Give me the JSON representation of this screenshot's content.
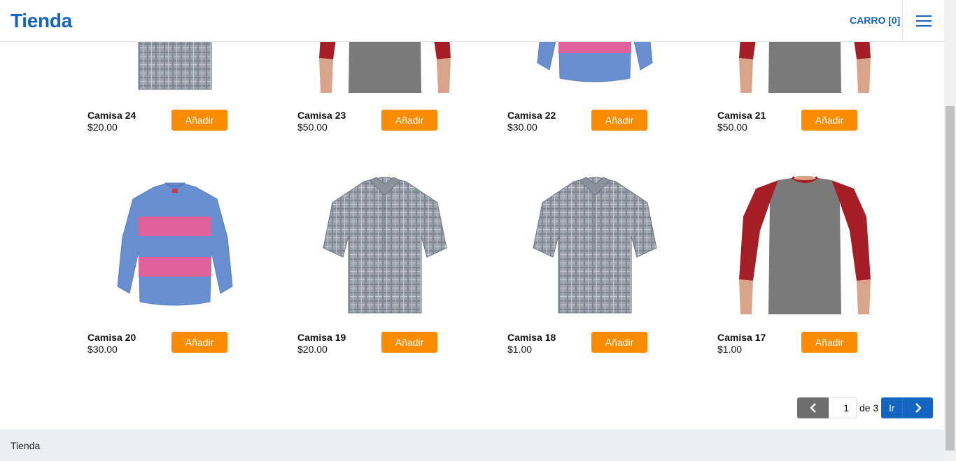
{
  "header": {
    "brand": "Tienda",
    "cart_label": "CARRO [0]"
  },
  "products": [
    {
      "name": "Camisa 24",
      "price": "$20.00",
      "button": "Añadir",
      "image": "plaid-shirt"
    },
    {
      "name": "Camisa 23",
      "price": "$50.00",
      "button": "Añadir",
      "image": "raglan-shirt"
    },
    {
      "name": "Camisa 22",
      "price": "$30.00",
      "button": "Añadir",
      "image": "striped-sweater"
    },
    {
      "name": "Camisa 21",
      "price": "$50.00",
      "button": "Añadir",
      "image": "raglan-shirt"
    },
    {
      "name": "Camisa 20",
      "price": "$30.00",
      "button": "Añadir",
      "image": "striped-sweater"
    },
    {
      "name": "Camisa 19",
      "price": "$20.00",
      "button": "Añadir",
      "image": "plaid-shirt"
    },
    {
      "name": "Camisa 18",
      "price": "$1.00",
      "button": "Añadir",
      "image": "plaid-shirt"
    },
    {
      "name": "Camisa 17",
      "price": "$1.00",
      "button": "Añadir",
      "image": "raglan-shirt"
    }
  ],
  "pagination": {
    "current_page": "1",
    "of_label": "de 3",
    "go_label": "Ir",
    "prev_icon": "chevron-left-icon",
    "next_icon": "chevron-right-icon"
  },
  "footer": {
    "text": "Tienda"
  },
  "colors": {
    "brand": "#1565c0",
    "add_button": "#fb8c00",
    "prev_button": "#6e6e6e",
    "footer_bg": "#eceff1"
  }
}
